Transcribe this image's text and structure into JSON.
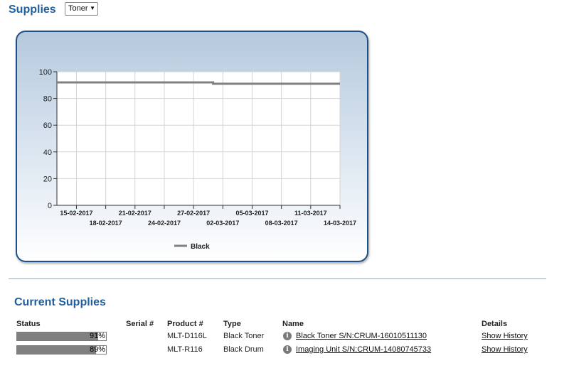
{
  "header": {
    "title": "Supplies",
    "filter_select": {
      "value": "Toner",
      "options": [
        "Toner"
      ]
    }
  },
  "colors": {
    "accent": "#1f5f9e",
    "card_border": "#1e4f86",
    "series_black": "#808080",
    "status_bar": "#808080"
  },
  "chart_data": {
    "type": "line",
    "title": "",
    "xlabel": "",
    "ylabel": "",
    "ylim": [
      0,
      100
    ],
    "yticks": [
      0,
      20,
      40,
      60,
      80,
      100
    ],
    "xlim": [
      "13-02-2017",
      "14-03-2017"
    ],
    "xtick_labels": [
      "15-02-2017",
      "18-02-2017",
      "21-02-2017",
      "24-02-2017",
      "27-02-2017",
      "02-03-2017",
      "05-03-2017",
      "08-03-2017",
      "11-03-2017",
      "14-03-2017"
    ],
    "grid": true,
    "legend_position": "bottom",
    "series": [
      {
        "name": "Black",
        "color": "#808080",
        "points": [
          {
            "x": "13-02-2017",
            "y": 92
          },
          {
            "x": "01-03-2017",
            "y": 92
          },
          {
            "x": "01-03-2017",
            "y": 91
          },
          {
            "x": "14-03-2017",
            "y": 91
          }
        ]
      }
    ]
  },
  "current_supplies": {
    "title": "Current Supplies",
    "columns": [
      "Status",
      "Serial #",
      "Product #",
      "Type",
      "Name",
      "Details"
    ],
    "rows": [
      {
        "status_percent": 91,
        "status_label": "91%",
        "serial": "",
        "product": "MLT-D116L",
        "type": "Black Toner",
        "name": "Black Toner S/N:CRUM-16010511130",
        "details": "Show History",
        "info_icon": "info-icon"
      },
      {
        "status_percent": 89,
        "status_label": "89%",
        "serial": "",
        "product": "MLT-R116",
        "type": "Black Drum",
        "name": "Imaging Unit S/N:CRUM-14080745733",
        "details": "Show History",
        "info_icon": "info-icon"
      }
    ]
  }
}
